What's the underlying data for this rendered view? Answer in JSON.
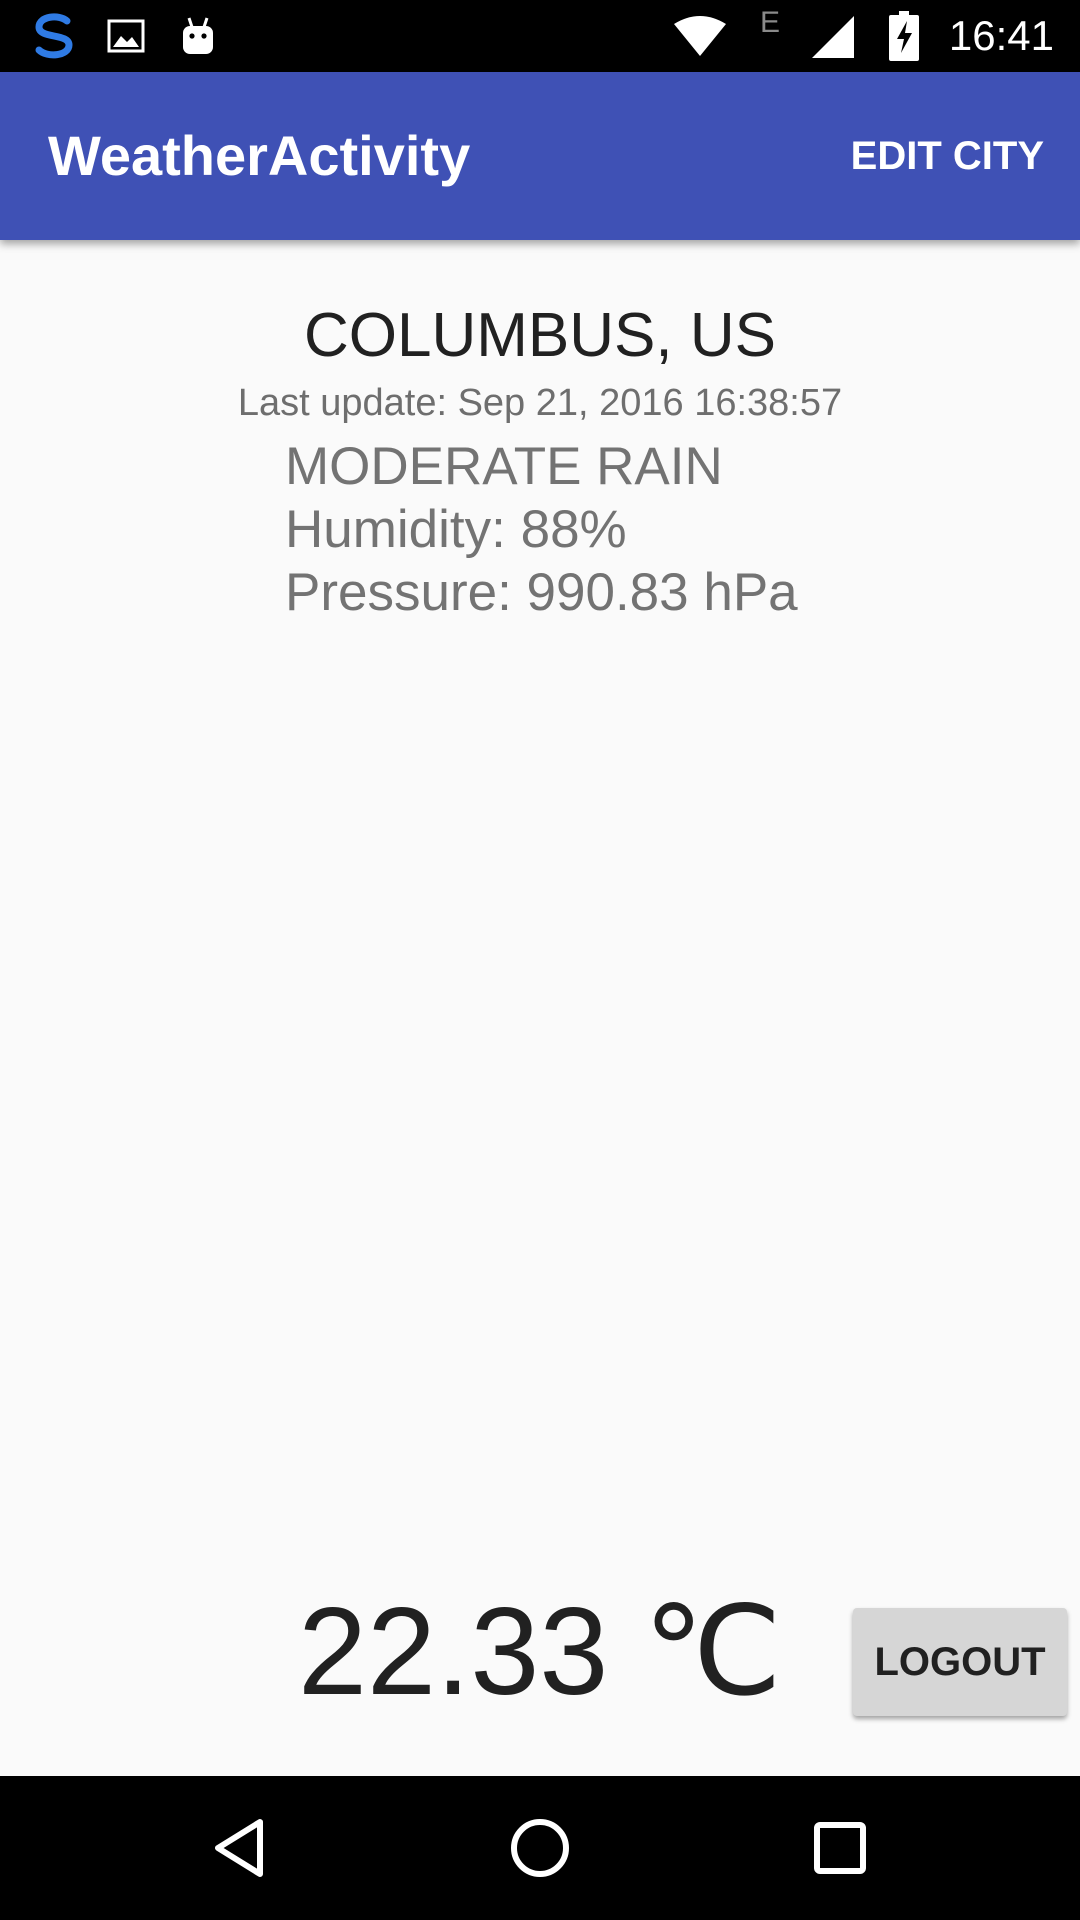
{
  "status_bar": {
    "time": "16:41",
    "network_type": "E",
    "icons": [
      "s-app-icon",
      "gallery-icon",
      "android-icon",
      "wifi-icon",
      "signal-icon",
      "battery-charging-icon"
    ]
  },
  "app_bar": {
    "title": "WeatherActivity",
    "action_label": "EDIT CITY",
    "color": "#3F51B5"
  },
  "weather": {
    "city": "COLUMBUS, US",
    "last_update": "Last update: Sep 21, 2016 16:38:57",
    "condition": "MODERATE RAIN",
    "humidity": "Humidity: 88%",
    "pressure": "Pressure: 990.83 hPa",
    "temperature": "22.33 ℃"
  },
  "actions": {
    "logout_label": "LOGOUT"
  },
  "nav_bar": {
    "icons": [
      "back-icon",
      "home-icon",
      "recents-icon"
    ]
  }
}
